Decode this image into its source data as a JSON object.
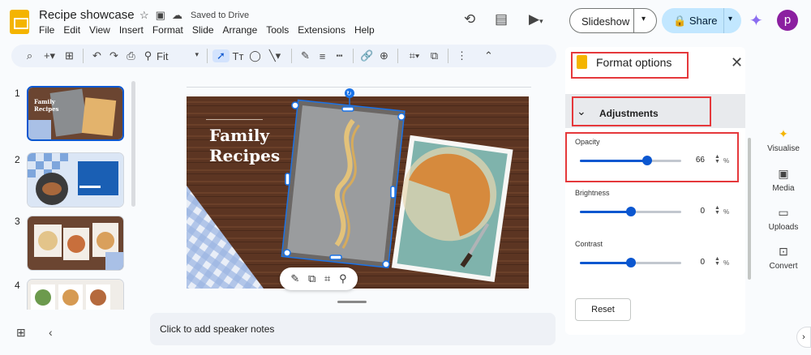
{
  "header": {
    "doc_title": "Recipe showcase",
    "saved_status": "Saved to Drive",
    "menu": [
      "File",
      "Edit",
      "View",
      "Insert",
      "Format",
      "Slide",
      "Arrange",
      "Tools",
      "Extensions",
      "Help"
    ],
    "slideshow_label": "Slideshow",
    "share_label": "Share",
    "avatar_letter": "p"
  },
  "toolbar": {
    "zoom_label": "Fit"
  },
  "filmstrip": {
    "slides": [
      {
        "number": "1",
        "mini_title": "Family Recipes"
      },
      {
        "number": "2"
      },
      {
        "number": "3"
      },
      {
        "number": "4"
      }
    ]
  },
  "slide": {
    "title_line1": "Family",
    "title_line2": "Recipes"
  },
  "notes": {
    "placeholder": "Click to add speaker notes"
  },
  "format_panel": {
    "title": "Format options",
    "section": "Adjustments",
    "sliders": [
      {
        "label": "Opacity",
        "value": "66",
        "level": 0.66,
        "unit": "%"
      },
      {
        "label": "Brightness",
        "value": "0",
        "level": 0.5,
        "unit": "%"
      },
      {
        "label": "Contrast",
        "value": "0",
        "level": 0.5,
        "unit": "%"
      }
    ],
    "reset_label": "Reset"
  },
  "right_rail": [
    {
      "label": "Visualise",
      "icon": "sparkle-icon"
    },
    {
      "label": "Media",
      "icon": "image-icon"
    },
    {
      "label": "Uploads",
      "icon": "folder-icon"
    },
    {
      "label": "Convert",
      "icon": "convert-icon"
    }
  ],
  "colors": {
    "accent": "#0b57d0",
    "share_bg": "#c2e7ff",
    "highlight": "#e5383b",
    "slides_brand": "#f4b400"
  }
}
